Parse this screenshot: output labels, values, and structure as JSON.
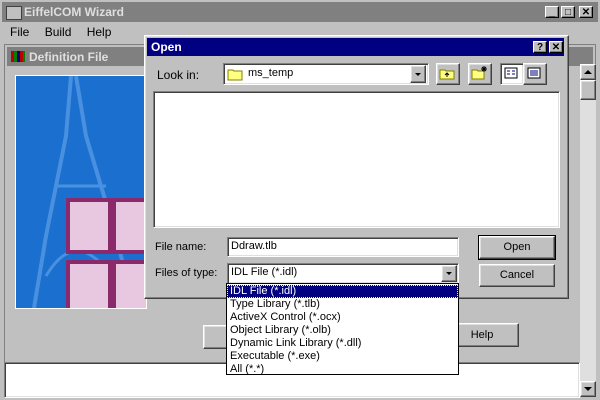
{
  "main_window": {
    "title": "EiffelCOM Wizard",
    "menu": [
      "File",
      "Build",
      "Help"
    ],
    "title_buttons": [
      "_",
      "□",
      "✕"
    ]
  },
  "definition_panel": {
    "title": "Definition File",
    "help_label": "Help"
  },
  "open_dialog": {
    "title": "Open",
    "look_in_label": "Look in:",
    "look_in_value": "ms_temp",
    "file_name_label": "File name:",
    "file_name_value": "Ddraw.tlb",
    "files_of_type_label": "Files of type:",
    "files_of_type_value": "IDL File (*.idl)",
    "open_label": "Open",
    "cancel_label": "Cancel",
    "help_glyph": "?",
    "close_glyph": "✕",
    "type_options": [
      "IDL File (*.idl)",
      "Type Library (*.tlb)",
      "ActiveX Control (*.ocx)",
      "Object Library (*.olb)",
      "Dynamic Link Library (*.dll)",
      "Executable (*.exe)",
      "All (*.*)"
    ]
  },
  "colors": {
    "active_title": "#000080",
    "inactive_title": "#808080",
    "face": "#c0c0c0",
    "image_blue": "#1a6fcf",
    "image_pink": "#e8c8e0",
    "image_magenta": "#8a2a6a"
  }
}
